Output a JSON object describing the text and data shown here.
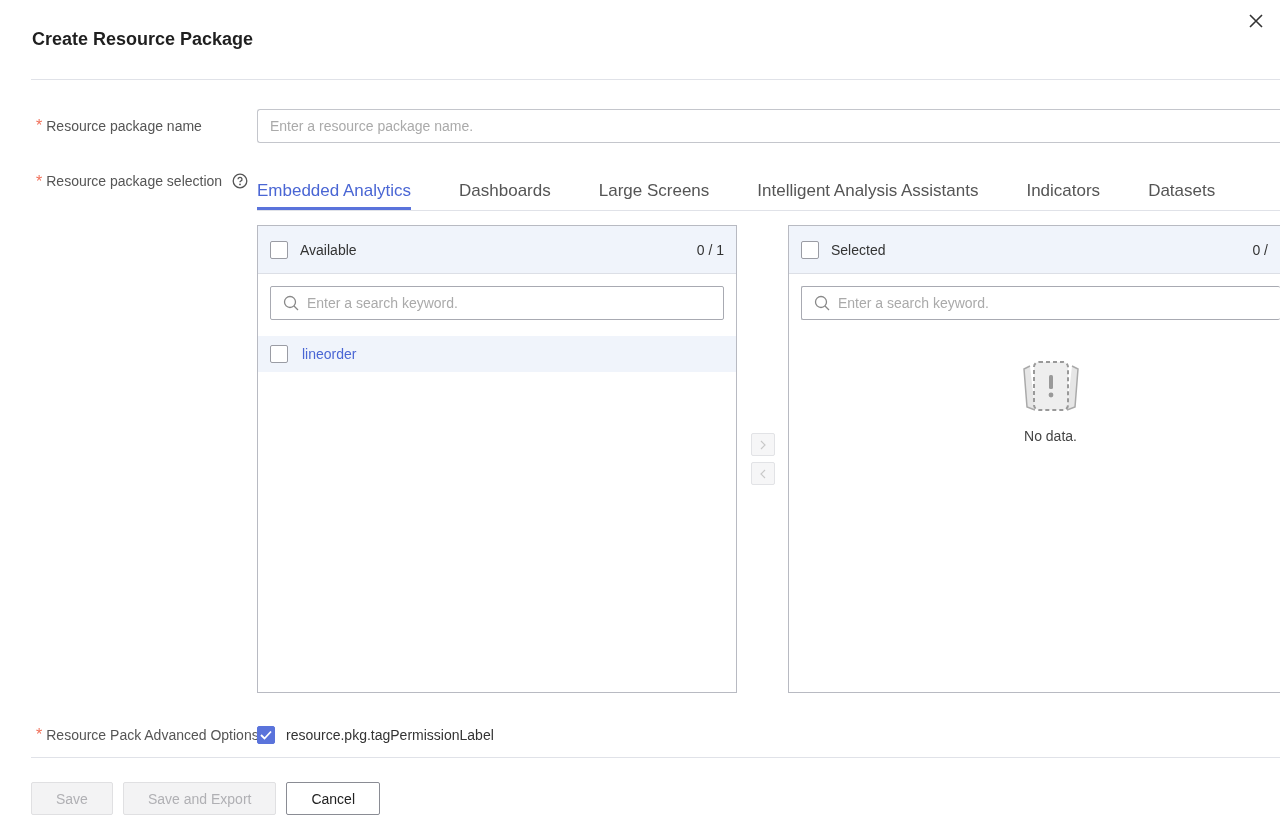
{
  "dialog": {
    "title": "Create Resource Package"
  },
  "name_field": {
    "label": "Resource package name",
    "required_mark": "*",
    "placeholder": "Enter a resource package name."
  },
  "selection_field": {
    "label": "Resource package selection",
    "required_mark": "*"
  },
  "tabs": [
    {
      "label": "Embedded Analytics",
      "selected": true
    },
    {
      "label": "Dashboards",
      "selected": false
    },
    {
      "label": "Large Screens",
      "selected": false
    },
    {
      "label": "Intelligent Analysis Assistants",
      "selected": false
    },
    {
      "label": "Indicators",
      "selected": false
    },
    {
      "label": "Datasets",
      "selected": false
    }
  ],
  "source_panel": {
    "title": "Available",
    "count": "0 / 1",
    "checked": false,
    "search_placeholder": "Enter a search keyword.",
    "items": [
      {
        "label": "lineorder",
        "checked": false,
        "highlighted": true
      }
    ]
  },
  "transfer_buttons": [
    {
      "kind": "right",
      "disabled": true
    },
    {
      "kind": "left",
      "disabled": true
    }
  ],
  "target_panel": {
    "title": "Selected",
    "count": "0 /",
    "checked": false,
    "search_placeholder": "Enter a search keyword.",
    "empty_text": "No data."
  },
  "advanced_field": {
    "label": "Resource Pack Advanced Options",
    "required_mark": "*",
    "option": {
      "label": "resource.pkg.tagPermissionLabel",
      "checked": true
    }
  },
  "buttons": [
    {
      "label": "Save",
      "disabled": true
    },
    {
      "label": "Save and Export",
      "disabled": true
    },
    {
      "label": "Cancel",
      "disabled": false
    }
  ]
}
